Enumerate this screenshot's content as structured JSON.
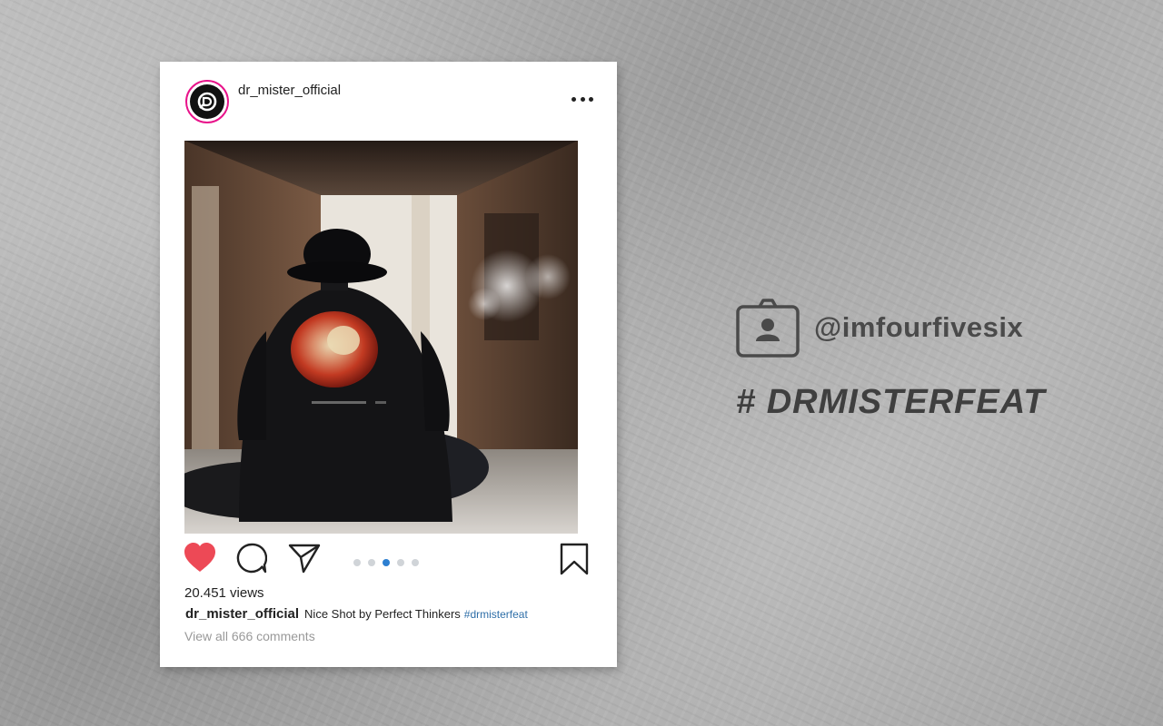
{
  "post": {
    "username": "dr_mister_official",
    "views": "20.451 views",
    "caption_user": "dr_mister_official",
    "caption_text": "Nice Shot by Perfect Thinkers",
    "caption_hashtag": "#drmisterfeat",
    "comments_link": "View all 666 comments",
    "carousel": {
      "total": 5,
      "active_index": 2
    },
    "liked": true,
    "colors": {
      "like": "#ed4956",
      "avatar_ring": "#e8138a",
      "active_dot": "#2d7fd1",
      "hashtag_link": "#2f6fa8"
    }
  },
  "side": {
    "handle": "@imfourfivesix",
    "hashtag": "# DRMISTERFEAT"
  }
}
